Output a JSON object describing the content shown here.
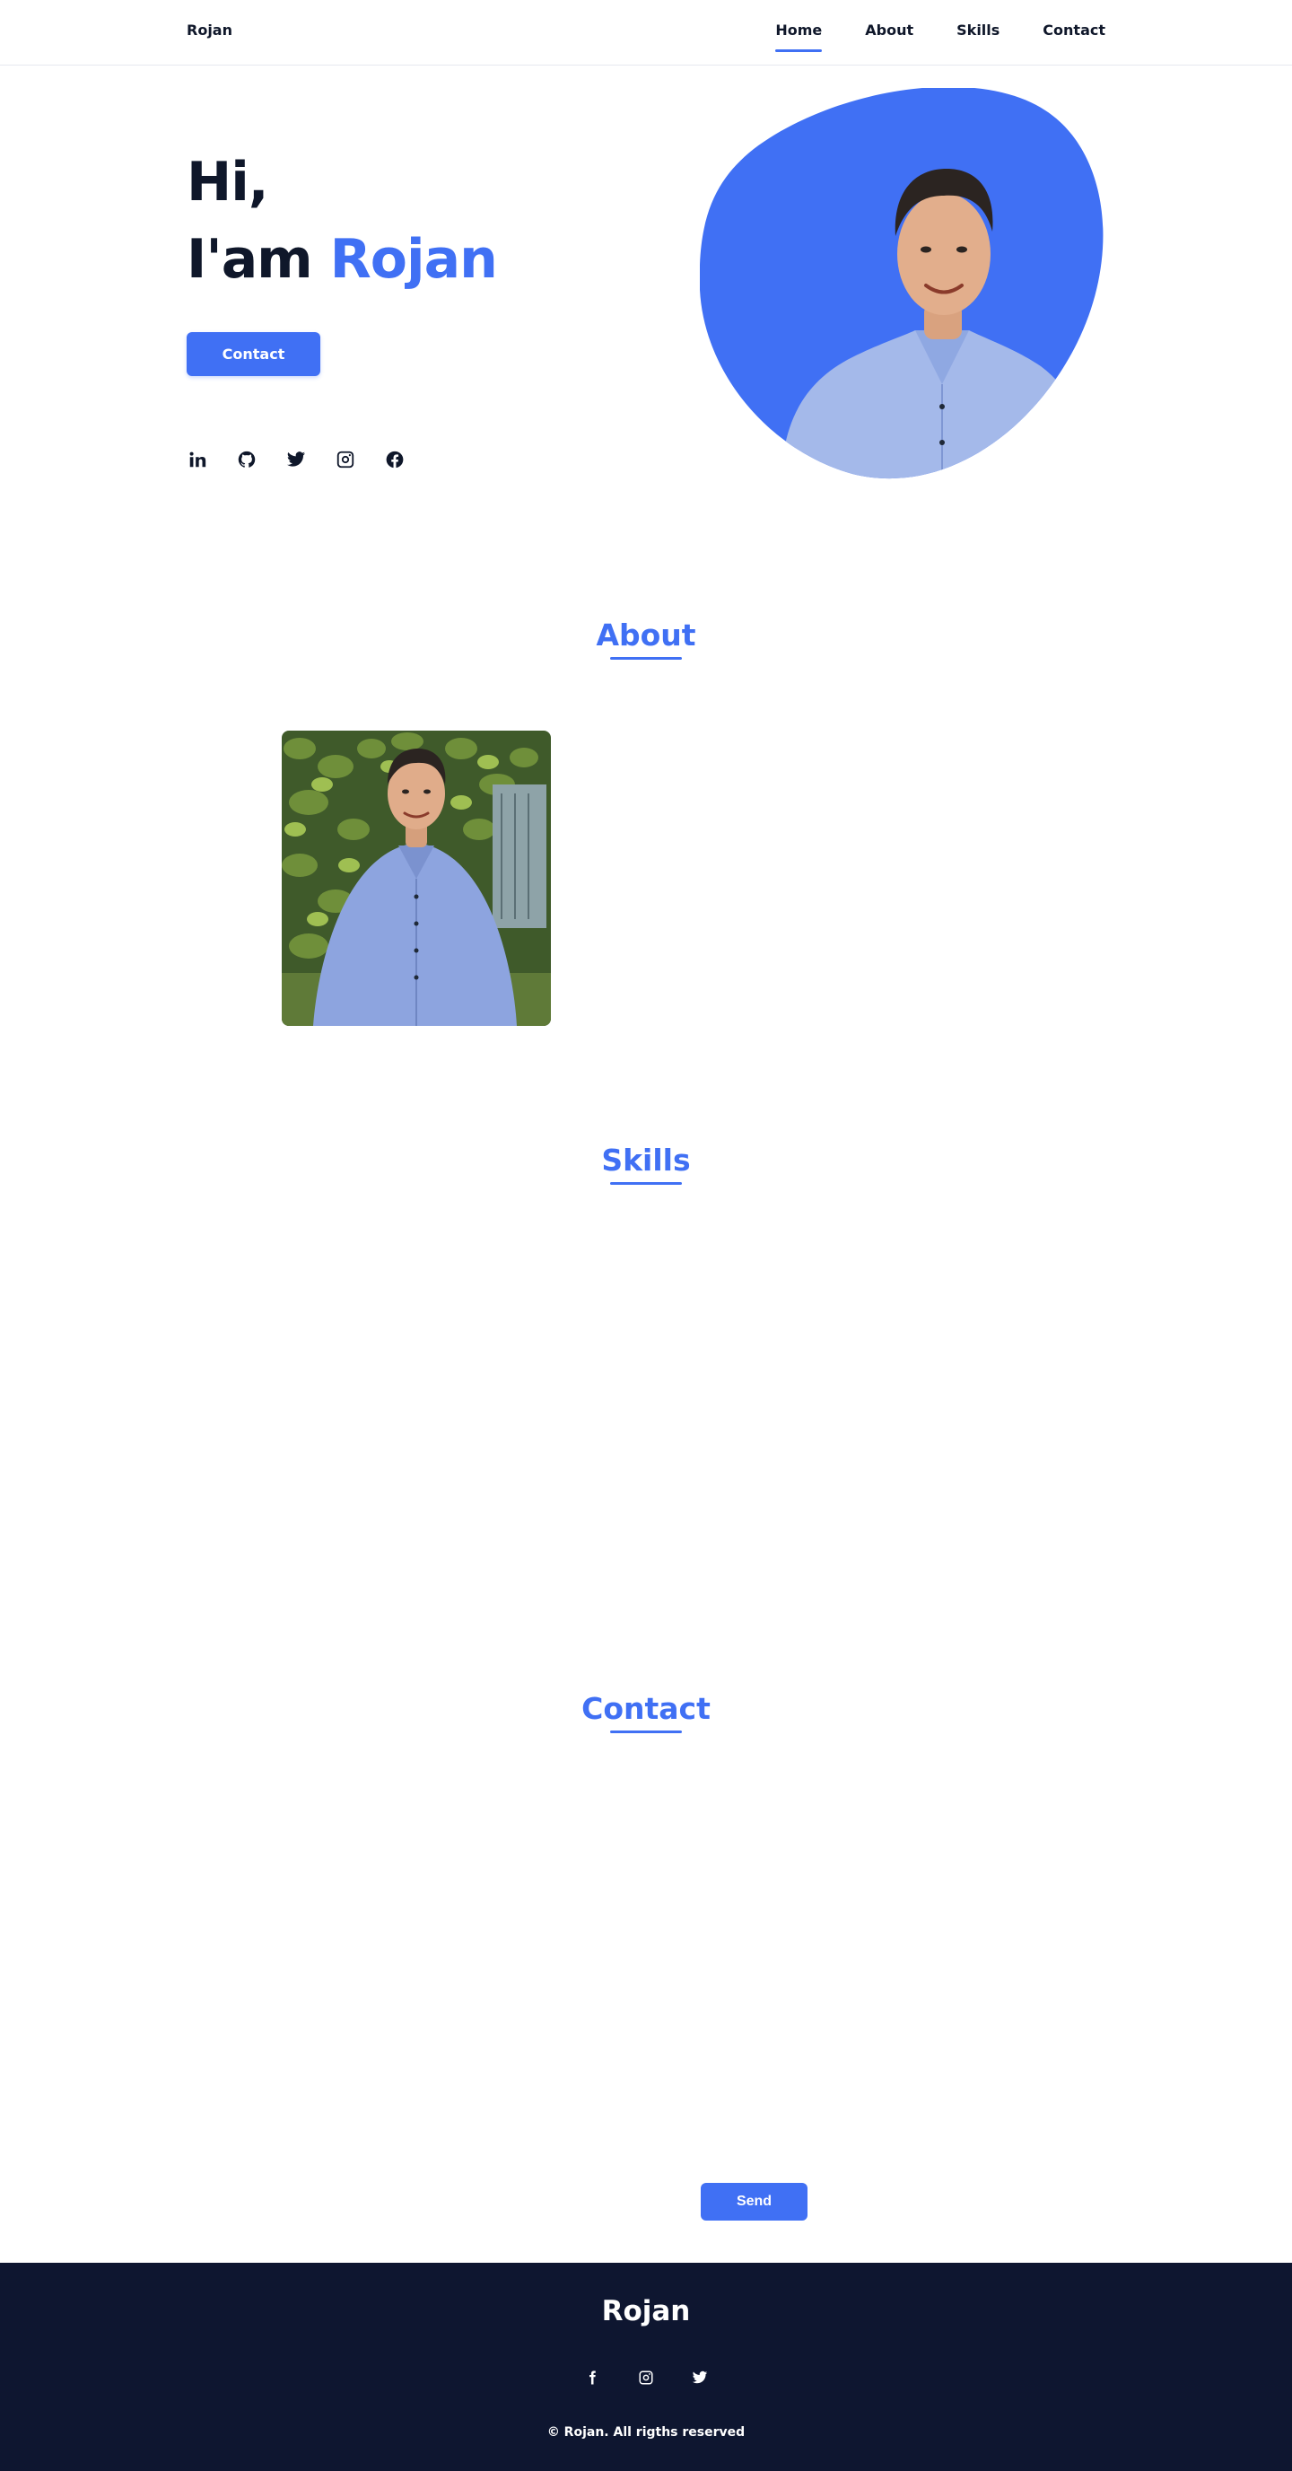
{
  "header": {
    "brand": "Rojan",
    "nav": [
      {
        "label": "Home",
        "active": true
      },
      {
        "label": "About",
        "active": false
      },
      {
        "label": "Skills",
        "active": false
      },
      {
        "label": "Contact",
        "active": false
      }
    ]
  },
  "hero": {
    "greeting": "Hi,",
    "intro": "I'am",
    "name": "Rojan",
    "cta_label": "Contact",
    "socials": [
      "linkedin-icon",
      "github-icon",
      "twitter-icon",
      "instagram-icon",
      "facebook-icon"
    ],
    "portrait": "person in a blue shirt smiling"
  },
  "about": {
    "title": "About",
    "photo": "person in a blue shirt standing in front of ivy"
  },
  "skills": {
    "title": "Skills"
  },
  "contact": {
    "title": "Contact",
    "send_label": "Send"
  },
  "footer": {
    "title": "Rojan",
    "socials": [
      "facebook-icon",
      "instagram-icon",
      "twitter-icon"
    ],
    "copyright": "© Rojan. All rigths reserved"
  },
  "colors": {
    "accent": "#4070f4",
    "text": "#0f172a",
    "footer_bg": "#0e1630"
  }
}
